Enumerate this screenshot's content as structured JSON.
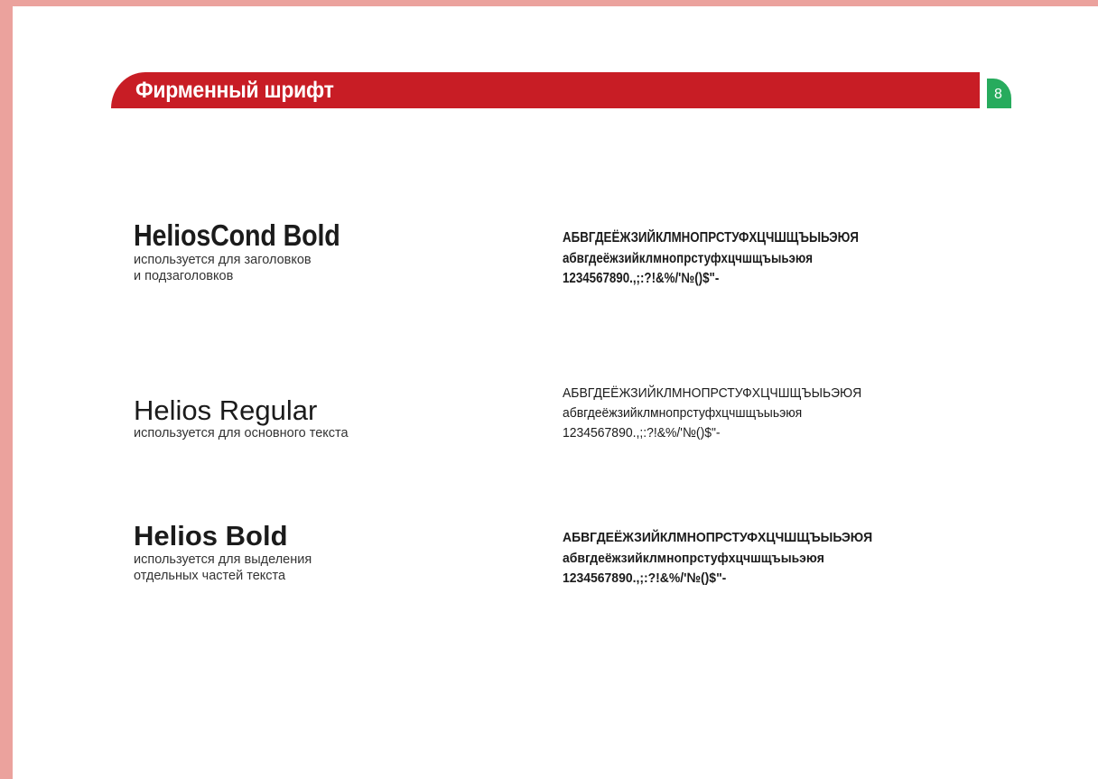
{
  "header": {
    "title": "Фирменный шрифт",
    "page_number": "8"
  },
  "colors": {
    "header_bar": "#c81d25",
    "page_badge": "#27ab5d",
    "frame": "#eba29d"
  },
  "fonts": [
    {
      "name": "HeliosCond Bold",
      "description": [
        "используется для заголовков",
        "и подзаголовков"
      ],
      "sample": {
        "upper": "АБВГДЕЁЖЗИЙКЛМНОПРСТУФХЦЧШЩЪЫЬЭЮЯ",
        "lower": "абвгдеёжзийклмнопрстуфхцчшщъыьэюя",
        "digits": "1234567890.,;:?!&%/'№()$\"-"
      }
    },
    {
      "name": "Helios Regular",
      "description": [
        "используется для основного текста"
      ],
      "sample": {
        "upper": "АБВГДЕЁЖЗИЙКЛМНОПРСТУФХЦЧШЩЪЫЬЭЮЯ",
        "lower": "абвгдеёжзийклмнопрстуфхцчшщъыьэюя",
        "digits": "1234567890.,;:?!&%/'№()$\"-"
      }
    },
    {
      "name": "Helios Bold",
      "description": [
        "используется для выделения",
        "отдельных частей текста"
      ],
      "sample": {
        "upper": "АБВГДЕЁЖЗИЙКЛМНОПРСТУФХЦЧШЩЪЫЬЭЮЯ",
        "lower": "абвгдеёжзийклмнопрстуфхцчшщъыьэюя",
        "digits": "1234567890.,;:?!&%/'№()$\"-"
      }
    }
  ]
}
